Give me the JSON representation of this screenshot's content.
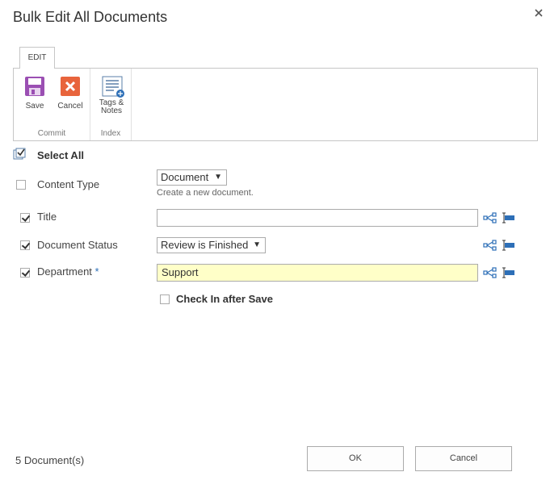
{
  "dialog": {
    "title": "Bulk Edit All Documents"
  },
  "ribbon": {
    "tab_label": "EDIT",
    "groups": {
      "commit": {
        "label": "Commit",
        "save_label": "Save",
        "cancel_label": "Cancel"
      },
      "index": {
        "label": "Index",
        "tags_label_line1": "Tags &",
        "tags_label_line2": "Notes"
      }
    }
  },
  "form": {
    "select_all_label": "Select All",
    "fields": {
      "content_type": {
        "label": "Content Type",
        "checked": false,
        "selected": "Document",
        "helper": "Create a new document."
      },
      "title": {
        "label": "Title",
        "checked": true,
        "value": ""
      },
      "document_status": {
        "label": "Document Status",
        "checked": true,
        "selected": "Review is Finished"
      },
      "department": {
        "label": "Department",
        "required_mark": "*",
        "checked": true,
        "value": "Support"
      }
    },
    "checkin_label": "Check In after Save",
    "checkin_checked": false
  },
  "footer": {
    "doc_count": "5  Document(s)",
    "ok_label": "OK",
    "cancel_label": "Cancel"
  },
  "colors": {
    "save_icon": "#9b4fb3",
    "cancel_icon": "#e8643c",
    "highlight_field": "#ffffc8",
    "icon_blue": "#2d6fb7"
  },
  "icons": [
    "close-icon",
    "save-icon",
    "cancel-icon",
    "tags-notes-icon",
    "select-all-icon",
    "workflow-icon",
    "field-properties-icon"
  ]
}
